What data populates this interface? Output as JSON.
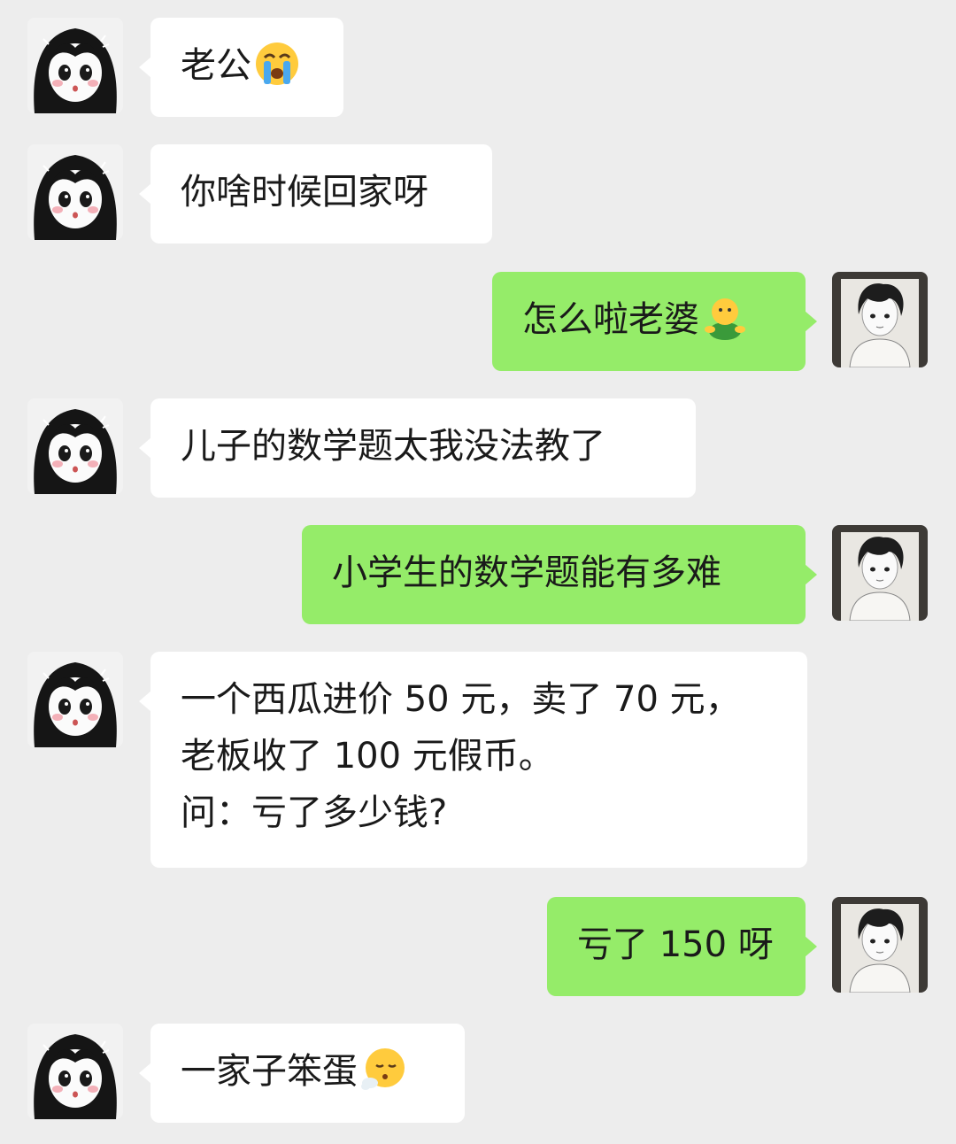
{
  "conversation": {
    "messages": [
      {
        "sender": "wife",
        "side": "left",
        "text": "老公",
        "emoji": "crying-face-emoji"
      },
      {
        "sender": "wife",
        "side": "left",
        "text": "你啥时候回家呀"
      },
      {
        "sender": "me",
        "side": "right",
        "text": "怎么啦老婆",
        "emoji": "green-figure-emoji"
      },
      {
        "sender": "wife",
        "side": "left",
        "text": "儿子的数学题太我没法教了"
      },
      {
        "sender": "me",
        "side": "right",
        "text": "小学生的数学题能有多难"
      },
      {
        "sender": "wife",
        "side": "left",
        "lines": [
          "一个西瓜进价 50 元，卖了 70 元，",
          "老板收了 100 元假币。",
          "问：亏了多少钱?"
        ]
      },
      {
        "sender": "me",
        "side": "right",
        "text": "亏了 150 呀"
      },
      {
        "sender": "wife",
        "side": "left",
        "text": "一家子笨蛋",
        "emoji": "face-exhaling-emoji"
      }
    ]
  },
  "colors": {
    "background": "#ededed",
    "incoming_bubble": "#ffffff",
    "outgoing_bubble": "#95ec69"
  }
}
